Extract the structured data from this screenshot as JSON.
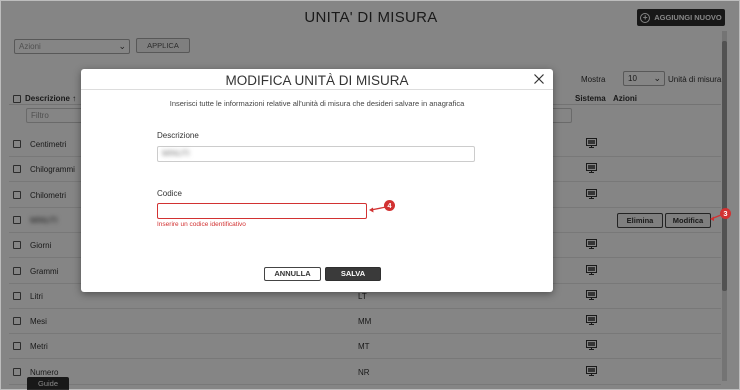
{
  "header": {
    "title": "UNITA' DI MISURA",
    "add_button_label": "AGGIUNGI NUOVO"
  },
  "toolbar": {
    "actions_placeholder": "Azioni",
    "apply_label": "APPLICA",
    "show_label": "Mostra",
    "page_size": "10",
    "units_label": "Unità di misura"
  },
  "table": {
    "columns": {
      "description": "Descrizione ↑",
      "system": "Sistema",
      "actions": "Azioni"
    },
    "filter_placeholder": "Filtro",
    "rows": [
      {
        "description": "Centimetri",
        "code": "",
        "system_icon": "monitor-icon"
      },
      {
        "description": "Chilogrammi",
        "code": "",
        "system_icon": "monitor-icon"
      },
      {
        "description": "Chilometri",
        "code": "",
        "system_icon": "monitor-icon"
      },
      {
        "description": "MINUTI",
        "code": "",
        "system_icon": ""
      },
      {
        "description": "Giorni",
        "code": "",
        "system_icon": "monitor-icon"
      },
      {
        "description": "Grammi",
        "code": "",
        "system_icon": "monitor-icon"
      },
      {
        "description": "Litri",
        "code": "LT",
        "system_icon": "monitor-icon"
      },
      {
        "description": "Mesi",
        "code": "MM",
        "system_icon": "monitor-icon"
      },
      {
        "description": "Metri",
        "code": "MT",
        "system_icon": "monitor-icon"
      },
      {
        "description": "Numero",
        "code": "NR",
        "system_icon": "monitor-icon"
      }
    ],
    "row_buttons": {
      "delete_label": "Elimina",
      "edit_label": "Modifica"
    }
  },
  "modal": {
    "title": "MODIFICA UNITÀ DI MISURA",
    "description": "Inserisci tutte le informazioni relative all'unità di misura che desideri salvare in anagrafica",
    "description_label": "Descrizione",
    "description_value": "MINUTI",
    "code_label": "Codice",
    "code_value": "",
    "code_error": "Inserire un codice identificativo",
    "cancel_label": "ANNULLA",
    "save_label": "SALVA"
  },
  "callouts": {
    "modal_code": "4",
    "edit_button": "3"
  },
  "footer": {
    "guide_label": "Guide"
  },
  "colors": {
    "accent_dark": "#2f2f2f",
    "error_red": "#d23232"
  }
}
